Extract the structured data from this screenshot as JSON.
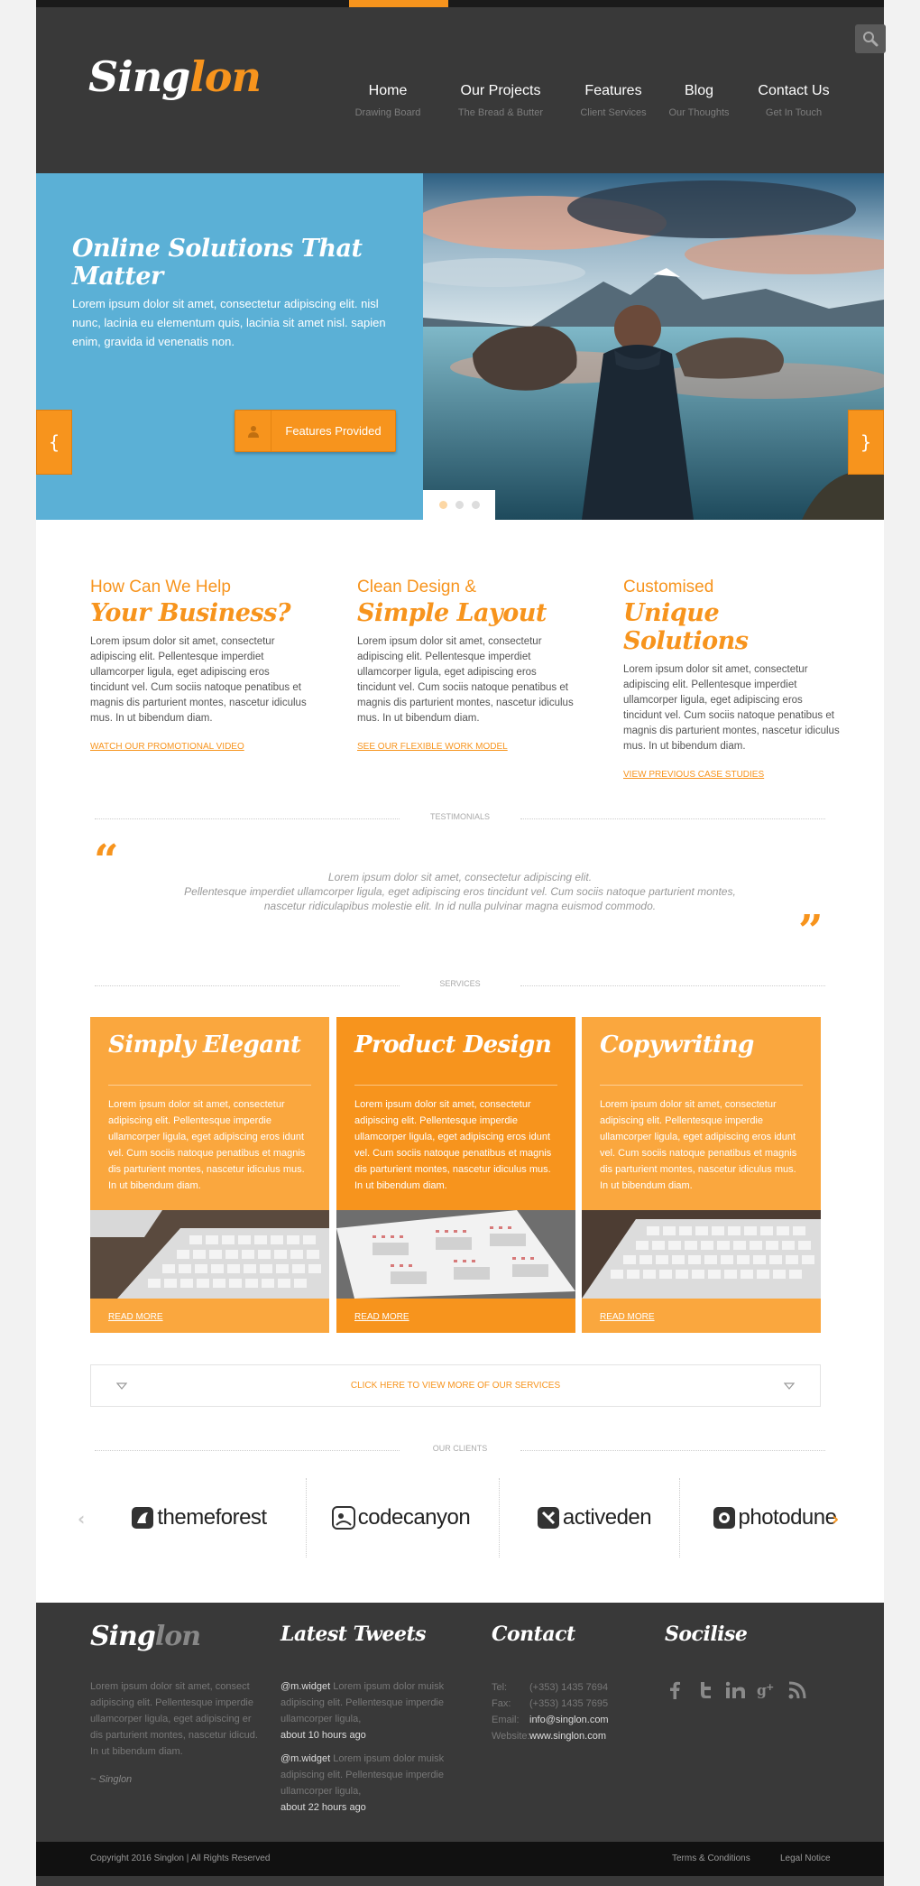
{
  "brand": {
    "logo_main": "Sing",
    "logo_accent": "lon",
    "accent_color": "#f7941d"
  },
  "header": {
    "search_icon": "search-icon",
    "nav": [
      {
        "label": "Home",
        "sub": "Drawing Board"
      },
      {
        "label": "Our Projects",
        "sub": "The Bread & Butter"
      },
      {
        "label": "Features",
        "sub": "Client Services"
      },
      {
        "label": "Blog",
        "sub": "Our Thoughts"
      },
      {
        "label": "Contact Us",
        "sub": "Get In Touch"
      }
    ]
  },
  "hero": {
    "title": "Online Solutions That Matter",
    "text": "Lorem ipsum dolor sit amet, consectetur adipiscing elit. nisl nunc, lacinia eu elementum quis, lacinia sit amet nisl. sapien enim, gravida id venenatis non.",
    "button_label": "Features Provided",
    "button_icon": "user-icon",
    "prev_label": "{",
    "next_label": "}",
    "slides": 3,
    "active_slide": 1
  },
  "features": [
    {
      "small": "How Can We Help",
      "big": "Your Business?",
      "text": "Lorem ipsum dolor sit amet, consectetur adipiscing elit. Pellentesque imperdiet ullamcorper ligula, eget adipiscing eros tincidunt vel. Cum sociis natoque penatibus et magnis dis parturient montes, nascetur idiculus mus. In ut bibendum diam.",
      "link": "WATCH OUR PROMOTIONAL VIDEO"
    },
    {
      "small": "Clean Design &",
      "big": "Simple Layout",
      "text": "Lorem ipsum dolor sit amet, consectetur adipiscing elit. Pellentesque imperdiet ullamcorper ligula, eget adipiscing eros tincidunt vel. Cum sociis natoque penatibus et magnis dis parturient montes, nascetur idiculus mus. In ut bibendum diam.",
      "link": "SEE OUR FLEXIBLE WORK MODEL"
    },
    {
      "small": "Customised",
      "big": "Unique Solutions",
      "text": "Lorem ipsum dolor sit amet, consectetur adipiscing elit. Pellentesque imperdiet ullamcorper ligula, eget adipiscing eros tincidunt vel. Cum sociis natoque penatibus et magnis dis parturient montes, nascetur idiculus mus. In ut bibendum diam.",
      "link": "VIEW PREVIOUS CASE STUDIES"
    }
  ],
  "testimonials": {
    "heading": "TESTIMONIALS",
    "open_quote": "“",
    "close_quote": "”",
    "line1": "Lorem ipsum dolor sit amet, consectetur adipiscing elit.",
    "line2": "Pellentesque imperdiet ullamcorper ligula, eget adipiscing eros tincidunt vel. Cum sociis natoque parturient montes,",
    "line3": "nascetur ridiculapibus molestie elit. In id nulla pulvinar magna euismod commodo."
  },
  "services": {
    "heading": "SERVICES",
    "items": [
      {
        "title": "Simply Elegant",
        "text": "Lorem ipsum dolor sit amet, consectetur adipiscing elit. Pellentesque imperdie ullamcorper ligula, eget adipiscing eros idunt vel. Cum sociis natoque penatibus et magnis dis parturient montes, nascetur idiculus mus. In ut bibendum diam.",
        "link": "READ MORE"
      },
      {
        "title": "Product Design",
        "text": "Lorem ipsum dolor sit amet, consectetur adipiscing elit. Pellentesque imperdie ullamcorper ligula, eget adipiscing eros idunt vel. Cum sociis natoque penatibus et magnis dis parturient montes, nascetur idiculus mus. In ut bibendum diam.",
        "link": "READ MORE"
      },
      {
        "title": "Copywriting",
        "text": "Lorem ipsum dolor sit amet, consectetur adipiscing elit. Pellentesque imperdie ullamcorper ligula, eget adipiscing eros idunt vel. Cum sociis natoque penatibus et magnis dis parturient montes, nascetur idiculus mus. In ut bibendum diam.",
        "link": "READ MORE"
      }
    ],
    "more_label": "CLICK HERE TO VIEW MORE OF OUR SERVICES"
  },
  "clients": {
    "heading": "OUR CLIENTS",
    "items": [
      "themeforest",
      "codecanyon",
      "activeden",
      "photodune"
    ]
  },
  "footer": {
    "about_text": "Lorem ipsum dolor sit amet, consect adipiscing elit. Pellentesque imperdie ullamcorper ligula, eget adipiscing er dis parturient montes, nascetur idicud. In ut bibendum diam.",
    "signature": "~ Singlon",
    "tweets_title": "Latest Tweets",
    "tweets": [
      {
        "handle": "@m.widget",
        "text": "Lorem ipsum dolor muisk adipiscing elit. Pellentesque imperdie ullamcorper ligula,",
        "time": "about 10 hours ago"
      },
      {
        "handle": "@m.widget",
        "text": "Lorem ipsum dolor muisk adipiscing elit. Pellentesque imperdie ullamcorper ligula,",
        "time": "about 22 hours ago"
      }
    ],
    "contact_title": "Contact",
    "contact": [
      {
        "k": "Tel:",
        "v": "(+353) 1435 7694",
        "bright": false
      },
      {
        "k": "Fax:",
        "v": "(+353) 1435 7695",
        "bright": false
      },
      {
        "k": "Email:",
        "v": "info@singlon.com",
        "bright": true
      },
      {
        "k": "Website:",
        "v": "www.singlon.com",
        "bright": true
      }
    ],
    "social_title": "Socilise",
    "social_icons": [
      "facebook-icon",
      "twitter-icon",
      "linkedin-icon",
      "google-plus-icon",
      "rss-icon"
    ]
  },
  "bottom": {
    "copyright": "Copyright 2016 Singlon | All Rights Reserved",
    "terms": "Terms & Conditions",
    "legal": "Legal Notice"
  }
}
